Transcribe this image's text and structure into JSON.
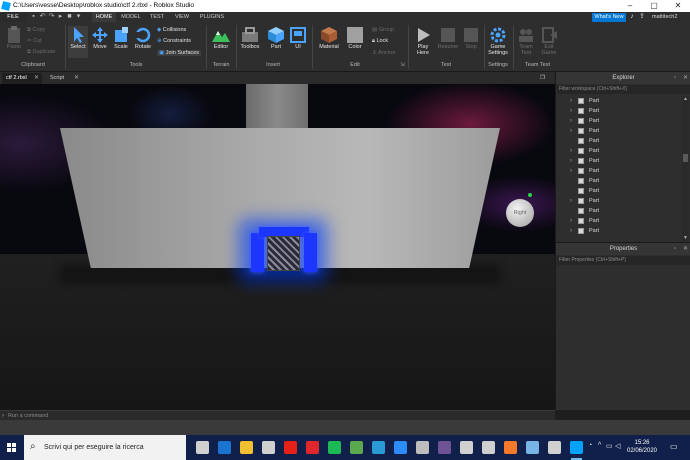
{
  "window": {
    "title": "C:\\Users\\vesse\\Desktop\\roblox studio\\ctf 2.rbxl - Roblox Studio",
    "controls": [
      "minimize-icon",
      "maximize-icon",
      "close-icon"
    ]
  },
  "ribbon_tabs": [
    {
      "label": "FILE"
    },
    {
      "label": "HOME"
    },
    {
      "label": "MODEL"
    },
    {
      "label": "TEST"
    },
    {
      "label": "VIEW"
    },
    {
      "label": "PLUGINS"
    }
  ],
  "topbar": {
    "whats_new": "What's New",
    "username": "mattitech2"
  },
  "ribbon": {
    "clipboard": {
      "paste": "Paste",
      "copy": "Copy",
      "cut": "Cut",
      "duplicate": "Duplicate",
      "label": "Clipboard"
    },
    "tools": {
      "select": "Select",
      "move": "Move",
      "scale": "Scale",
      "rotate": "Rotate",
      "collisions": "Collisions",
      "constraints": "Constraints",
      "join_surfaces": "Join Surfaces",
      "label": "Tools"
    },
    "terrain": {
      "editor": "Editor",
      "label": "Terrain"
    },
    "insert": {
      "toolbox": "Toolbox",
      "part": "Part",
      "ui": "UI",
      "label": "Insert"
    },
    "edit": {
      "material": "Material",
      "color": "Color",
      "group": "Group",
      "lock": "Lock",
      "anchor": "Anchor",
      "label": "Edit"
    },
    "test": {
      "play_here": "Play",
      "play_here2": "Here",
      "resume": "Resume",
      "stop": "Stop",
      "label": "Test"
    },
    "settings": {
      "game_settings": "Game",
      "game_settings2": "Settings",
      "label": "Settings"
    },
    "team_test": {
      "team_test": "Team",
      "team_test2": "Test",
      "exit_game": "Exit",
      "exit_game2": "Game",
      "label": "Team Test"
    }
  },
  "doc_tabs": [
    {
      "label": "ctf 2.rbxl"
    },
    {
      "label": "Script"
    }
  ],
  "viewport": {
    "viewcube_label": "Right"
  },
  "command_bar": {
    "placeholder": "Run a command"
  },
  "explorer": {
    "title": "Explorer",
    "filter_placeholder": "Filter workspace (Ctrl+Shift+X)",
    "items": [
      {
        "label": "Part",
        "expandable": true
      },
      {
        "label": "Part",
        "expandable": true
      },
      {
        "label": "Part",
        "expandable": true
      },
      {
        "label": "Part",
        "expandable": true
      },
      {
        "label": "Part",
        "expandable": false
      },
      {
        "label": "Part",
        "expandable": true
      },
      {
        "label": "Part",
        "expandable": true
      },
      {
        "label": "Part",
        "expandable": true
      },
      {
        "label": "Part",
        "expandable": false
      },
      {
        "label": "Part",
        "expandable": false
      },
      {
        "label": "Part",
        "expandable": true
      },
      {
        "label": "Part",
        "expandable": false
      },
      {
        "label": "Part",
        "expandable": true
      },
      {
        "label": "Part",
        "expandable": true
      }
    ]
  },
  "properties": {
    "title": "Properties",
    "filter_placeholder": "Filter Properties (Ctrl+Shift+P)"
  },
  "taskbar": {
    "search_placeholder": "Scrivi qui per eseguire la ricerca",
    "time": "15:26",
    "date": "02/06/2020",
    "apps": [
      {
        "name": "task-view-icon",
        "color": "#d0d0d0"
      },
      {
        "name": "edge-icon",
        "color": "#1b75d0"
      },
      {
        "name": "file-explorer-icon",
        "color": "#f0c030"
      },
      {
        "name": "store-icon",
        "color": "#d0d0d0"
      },
      {
        "name": "youtube-icon",
        "color": "#e62117"
      },
      {
        "name": "red-app-icon",
        "color": "#e0282c"
      },
      {
        "name": "spotify-icon",
        "color": "#1db954"
      },
      {
        "name": "chrome-icon",
        "color": "#5ba84f"
      },
      {
        "name": "edge-chromium-icon",
        "color": "#2a9ad6"
      },
      {
        "name": "zoom-icon",
        "color": "#2d8cff"
      },
      {
        "name": "mail-icon",
        "color": "#bdbdbd"
      },
      {
        "name": "writer-icon",
        "color": "#6e5494"
      },
      {
        "name": "unity-icon",
        "color": "#d0d0d0"
      },
      {
        "name": "cube-app-icon",
        "color": "#cfcfcf"
      },
      {
        "name": "blender-icon",
        "color": "#f5792a"
      },
      {
        "name": "cloud-app-icon",
        "color": "#79b4e6"
      },
      {
        "name": "roblox-icon",
        "color": "#d0d0d0"
      },
      {
        "name": "roblox-studio-icon",
        "color": "#00a2ff"
      }
    ]
  },
  "colors": {
    "accent": "#0078d4",
    "neon_blue": "#1c35ff",
    "taskbar": "#10204a"
  }
}
